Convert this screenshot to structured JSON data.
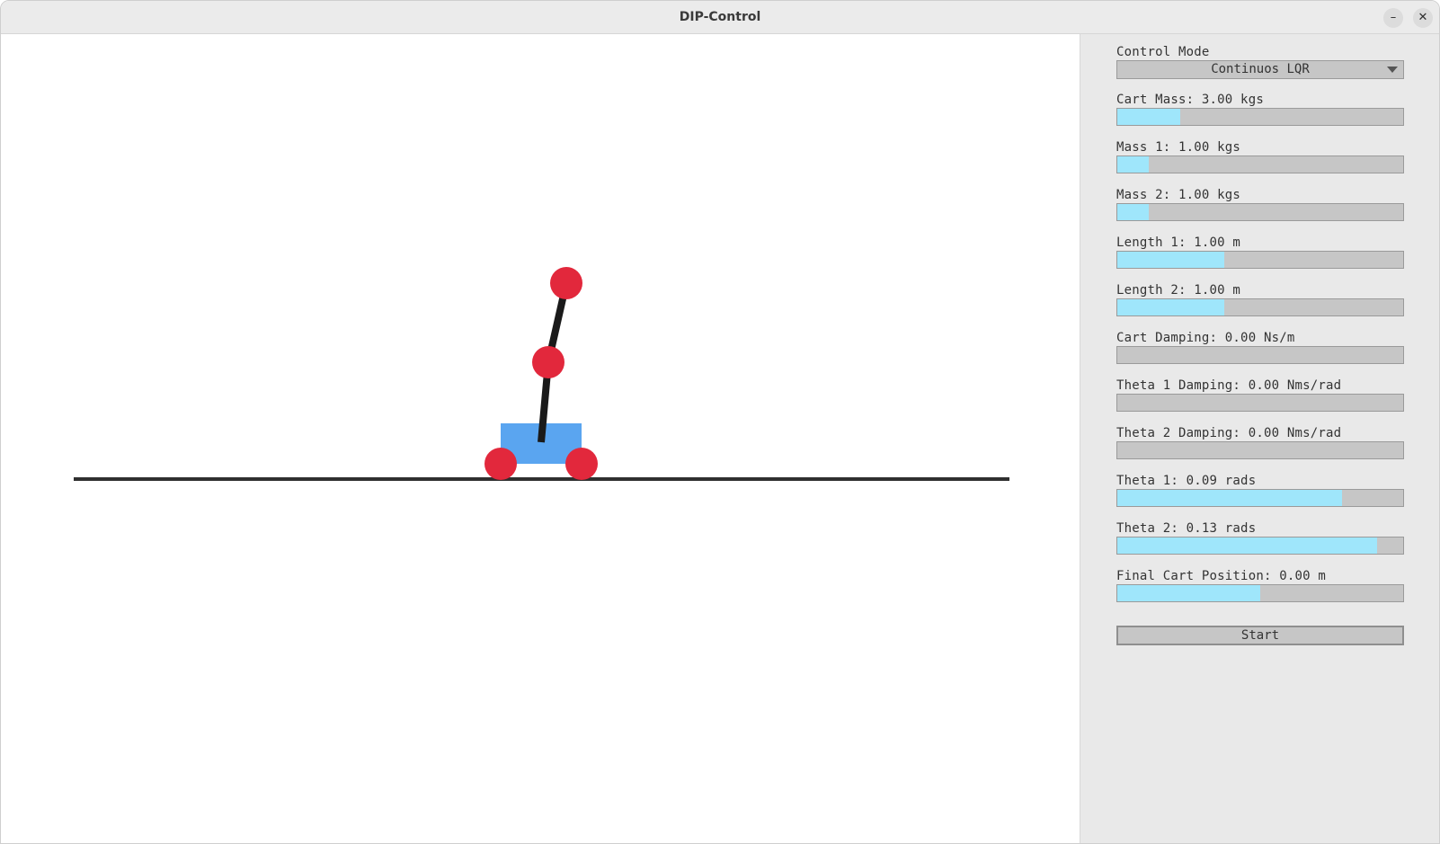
{
  "window": {
    "title": "DIP-Control"
  },
  "titlebar": {
    "minimize_glyph": "–",
    "close_glyph": "✕"
  },
  "simulation": {
    "track_color": "#2f2f2f",
    "cart_color": "#5aa5f0",
    "joint_color": "#e2283c",
    "link_color": "#1a1a1a",
    "theta1_rad": 0.09,
    "theta2_rad": 0.13
  },
  "panel": {
    "control_mode": {
      "label": "Control Mode",
      "value": "Continuos LQR"
    },
    "sliders": [
      {
        "id": "cart-mass",
        "label": "Cart Mass: 3.00 kgs",
        "fill_fraction": 0.22
      },
      {
        "id": "mass-1",
        "label": "Mass 1: 1.00 kgs",
        "fill_fraction": 0.11
      },
      {
        "id": "mass-2",
        "label": "Mass 2: 1.00 kgs",
        "fill_fraction": 0.11
      },
      {
        "id": "length-1",
        "label": "Length 1: 1.00 m",
        "fill_fraction": 0.375
      },
      {
        "id": "length-2",
        "label": "Length 2: 1.00 m",
        "fill_fraction": 0.375
      },
      {
        "id": "cart-damping",
        "label": "Cart Damping: 0.00 Ns/m",
        "fill_fraction": 0.0
      },
      {
        "id": "theta-1-damping",
        "label": "Theta 1 Damping: 0.00 Nms/rad",
        "fill_fraction": 0.0
      },
      {
        "id": "theta-2-damping",
        "label": "Theta 2 Damping: 0.00 Nms/rad",
        "fill_fraction": 0.0
      },
      {
        "id": "theta-1",
        "label": "Theta 1: 0.09 rads",
        "fill_fraction": 0.785
      },
      {
        "id": "theta-2",
        "label": "Theta 2: 0.13 rads",
        "fill_fraction": 0.91
      },
      {
        "id": "final-cart-position",
        "label": "Final Cart Position: 0.00 m",
        "fill_fraction": 0.5
      }
    ],
    "start_label": "Start",
    "slider_fill_color": "#9fe6fb",
    "slider_track_color": "#c6c6c6"
  }
}
